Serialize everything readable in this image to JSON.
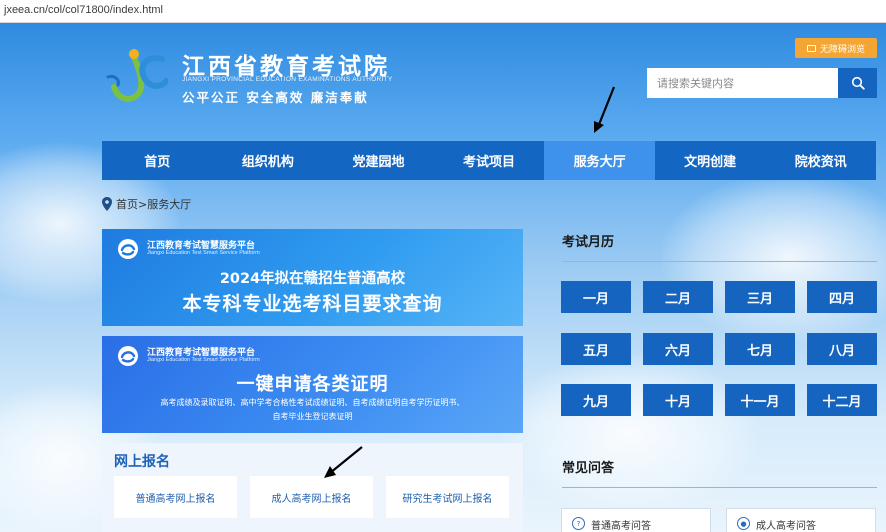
{
  "browser": {
    "url": "jxeea.cn/col/col71800/index.html"
  },
  "header": {
    "title_cn": "江西省教育考试院",
    "title_en": "JIANGXI PROVINCIAL EDUCATION EXAMINATIONS AUTHORITY",
    "slogan": "公平公正  安全高效  廉洁奉献",
    "elder_mode_label": "无障碍浏览",
    "search_placeholder": "请搜索关键内容"
  },
  "nav": {
    "items": [
      {
        "label": "首页"
      },
      {
        "label": "组织机构"
      },
      {
        "label": "党建园地"
      },
      {
        "label": "考试项目"
      },
      {
        "label": "服务大厅",
        "active": true
      },
      {
        "label": "文明创建"
      },
      {
        "label": "院校资讯"
      }
    ]
  },
  "breadcrumb": {
    "text": "首页>服务大厅"
  },
  "banners": [
    {
      "platform_name": "江西教育考试智慧服务平台",
      "platform_name_en": "Jiangxi Education Test Smart Service Platform",
      "line1": "2024年拟在赣招生普通高校",
      "line2": "本专科专业选考科目要求查询"
    },
    {
      "platform_name": "江西教育考试智慧服务平台",
      "platform_name_en": "Jiangxi Education Test Smart Service Platform",
      "main": "一键申请各类证明",
      "sub1": "高考成绩及录取证明、高中学考合格性考试成绩证明、自考成绩证明自考学历证明书、",
      "sub2": "自考毕业生登记表证明"
    }
  ],
  "online_registration": {
    "title": "网上报名",
    "buttons": [
      {
        "label": "普通高考网上报名"
      },
      {
        "label": "成人高考网上报名"
      },
      {
        "label": "研究生考试网上报名"
      }
    ]
  },
  "exam_calendar": {
    "title": "考试月历",
    "months": [
      "一月",
      "二月",
      "三月",
      "四月",
      "五月",
      "六月",
      "七月",
      "八月",
      "九月",
      "十月",
      "十一月",
      "十二月"
    ]
  },
  "faq": {
    "title": "常见问答",
    "items": [
      {
        "label": "普通高考问答"
      },
      {
        "label": "成人高考问答"
      }
    ]
  },
  "colors": {
    "nav_bg": "#1366c2",
    "nav_active": "#3e92ec",
    "month_button": "#1565c0",
    "elder_button": "#f3a634"
  }
}
